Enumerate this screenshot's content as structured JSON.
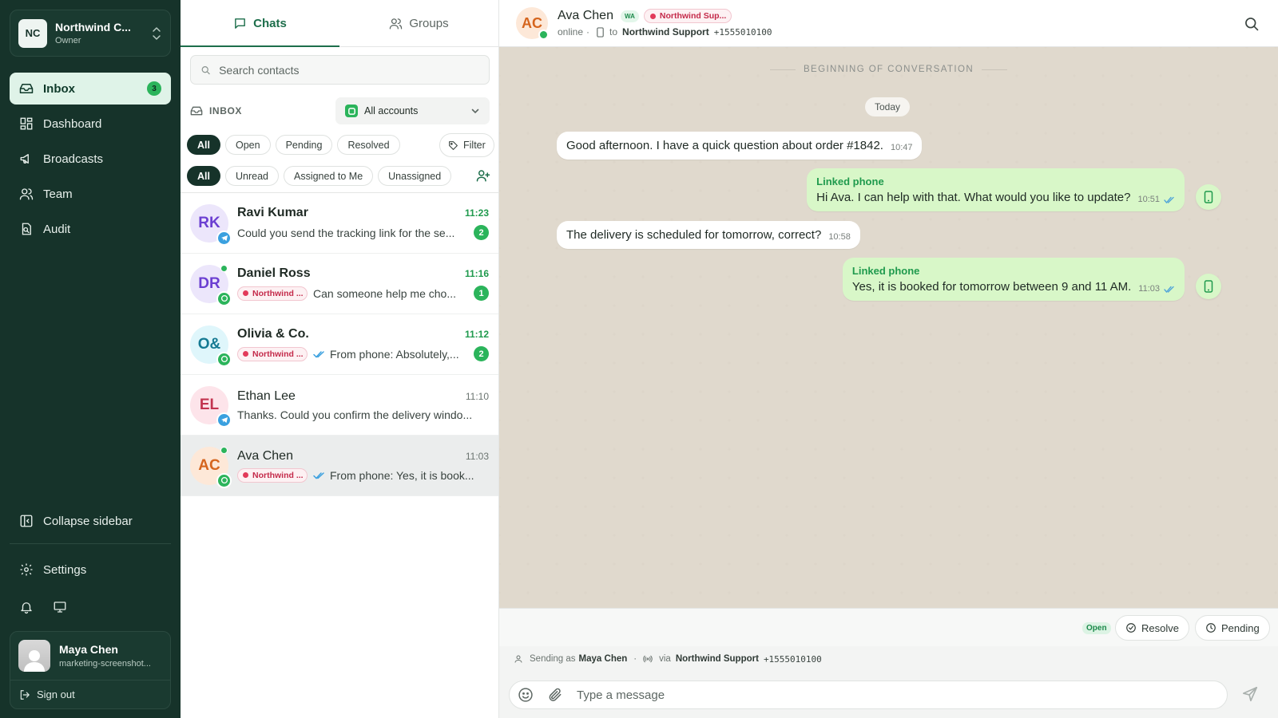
{
  "org": {
    "initials": "NC",
    "name": "Northwind C...",
    "role": "Owner"
  },
  "nav": [
    {
      "label": "Inbox",
      "badge": "3"
    },
    {
      "label": "Dashboard"
    },
    {
      "label": "Broadcasts"
    },
    {
      "label": "Team"
    },
    {
      "label": "Audit"
    }
  ],
  "sidebar_footer": {
    "collapse": "Collapse sidebar",
    "settings": "Settings"
  },
  "user": {
    "name": "Maya Chen",
    "email": "marketing-screenshot...",
    "signout": "Sign out"
  },
  "tabs": {
    "chats": "Chats",
    "groups": "Groups"
  },
  "search": {
    "placeholder": "Search contacts"
  },
  "inbox": {
    "label": "INBOX",
    "account_select": "All accounts"
  },
  "status_filters": [
    "All",
    "Open",
    "Pending",
    "Resolved"
  ],
  "filter_label": "Filter",
  "assign_filters": [
    "All",
    "Unread",
    "Assigned to Me",
    "Unassigned"
  ],
  "conversations": [
    {
      "initials": "RK",
      "name": "Ravi Kumar",
      "time": "11:23",
      "preview": "Could you send the tracking link for the se...",
      "unread": "2",
      "tag": ""
    },
    {
      "initials": "DR",
      "name": "Daniel Ross",
      "time": "11:16",
      "preview": "Can someone help me cho...",
      "unread": "1",
      "tag": "Northwind ..."
    },
    {
      "initials": "O&",
      "name": "Olivia & Co.",
      "time": "11:12",
      "preview": "From phone: Absolutely,...",
      "unread": "2",
      "tag": "Northwind ..."
    },
    {
      "initials": "EL",
      "name": "Ethan Lee",
      "time": "11:10",
      "preview": "Thanks. Could you confirm the delivery windo...",
      "unread": "",
      "tag": ""
    },
    {
      "initials": "AC",
      "name": "Ava Chen",
      "time": "11:03",
      "preview": "From phone: Yes, it is book...",
      "unread": "",
      "tag": "Northwind ..."
    }
  ],
  "header": {
    "initials": "AC",
    "name": "Ava Chen",
    "channel": "WA",
    "account": "Northwind Sup...",
    "status": "online",
    "dot": "·",
    "to": "to",
    "account_name": "Northwind Support",
    "phone": "+1555010100"
  },
  "conversation": {
    "begin": "BEGINNING OF CONVERSATION",
    "day": "Today",
    "messages": [
      {
        "text": "Good afternoon. I have a quick question about order #1842.",
        "time": "10:47",
        "source": ""
      },
      {
        "text": "Hi Ava. I can help with that. What would you like to update?",
        "time": "10:51",
        "source": "Linked phone"
      },
      {
        "text": "The delivery is scheduled for tomorrow, correct?",
        "time": "10:58",
        "source": ""
      },
      {
        "text": "Yes, it is booked for tomorrow between 9 and 11 AM.",
        "time": "11:03",
        "source": "Linked phone"
      }
    ]
  },
  "status_bar": {
    "badge": "Open",
    "resolve": "Resolve",
    "pending": "Pending"
  },
  "sending": {
    "prefix": "Sending as",
    "agent": "Maya Chen",
    "dot": "·",
    "via": "via",
    "account": "Northwind Support",
    "phone": "+1555010100"
  },
  "composer": {
    "placeholder": "Type a message"
  },
  "colors": {
    "sidebar": "#16332a",
    "accent": "#1d6e4b",
    "unread": "#2bb45b",
    "outgoing_bubble": "#d8f7c8",
    "chat_bg": "#ece6dc",
    "account_tag": "#c42a4a"
  }
}
